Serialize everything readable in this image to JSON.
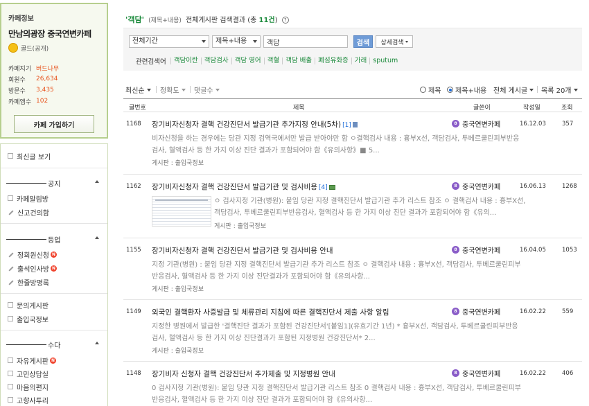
{
  "cafe": {
    "section_label": "카페정보",
    "name": "만남의광장 중국연변카페",
    "grade": "골드(공개)",
    "stats": [
      {
        "label": "카페지기",
        "value": "버드나무"
      },
      {
        "label": "회원수",
        "value": "26,634"
      },
      {
        "label": "방문수",
        "value": "3,435"
      },
      {
        "label": "카페앱수",
        "value": "102"
      }
    ],
    "join_button": "카페 가입하기"
  },
  "menu": {
    "latest": "최신글 보기",
    "group_notice": "공지",
    "notice_items": [
      "카페알림방",
      "신고건의함"
    ],
    "group_rating": "등업",
    "rating_items": [
      "정회원신청",
      "출석인사방",
      "한줄방명록"
    ],
    "misc_items": [
      "문의게시판",
      "출입국정보"
    ],
    "group_chat": "수다",
    "chat_items": [
      "자유게시판",
      "고민상담실",
      "마음의편지",
      "고향사투리"
    ]
  },
  "search": {
    "query": "'객담'",
    "scope": "(제목+내용)",
    "summary_pre": "전체게시판 검색결과 (총 ",
    "count": "11건",
    "summary_post": ")",
    "help": "?",
    "period": "전체기간",
    "field": "제목+내용",
    "input_value": "객담",
    "button": "검색",
    "advanced": "상세검색",
    "related_label": "관련검색어",
    "related": [
      "객담이란",
      "객담검사",
      "객담 영어",
      "객혈",
      "객담 배출",
      "폐섬유화증",
      "가래",
      "sputum"
    ]
  },
  "sort": {
    "latest": "최신순",
    "accuracy": "정확도",
    "comments": "댓글수",
    "radio_title": "제목",
    "radio_title_content": "제목+내용",
    "board_filter": "전체 게시글",
    "list_size": "목록 20개"
  },
  "table": {
    "headers": {
      "num": "글번호",
      "title": "제목",
      "author": "글쓴이",
      "date": "작성일",
      "views": "조회"
    },
    "rows": [
      {
        "num": "1168",
        "title": "장기비자신청자 결핵 건강진단서 발급기관 추가지정 안내(5차)",
        "comments": "[1]",
        "snippet": [
          "비자신청을 하는 경우에는 당관 지정 검역국에서만 발급 받아야만 함 ㅇ결핵검사 내용 : 흉부X선, 객담검사, 투베르쿨린피부반응",
          "검사, 혈액검사 등 한 가지 이상 진단 결과가 포함되어야 함《유의사항》■ 5..."
        ],
        "board": "게시판 : 출입국정보",
        "author": "중국연변카페",
        "level": "8",
        "date": "16.12.03",
        "views": "357"
      },
      {
        "num": "1162",
        "title": "장기비자신청자 결핵 건강진단서 발급기관 및 검사비용",
        "comments": "[4]",
        "snippet": [
          "ㅇ 검사지정 기관(병원): 붙임 당관 지정 결핵진단서 발급기관 추가 리스트 참조 ㅇ 결핵검사 내용 : 흉부X선,",
          "객담검사, 투베르쿨린피부반응검사, 혈액검사 등 한 가지 이상 진단 결과가 포함되어야 함《유의..."
        ],
        "board": "게시판 : 출입국정보",
        "author": "중국연변카페",
        "level": "8",
        "date": "16.06.13",
        "views": "1268"
      },
      {
        "num": "1155",
        "title": "장기비자신청자 결핵 건강진단서 발급기관 및 검사비용 안내",
        "comments": "",
        "snippet": [
          "지정 기관(병원) : 붙임 당관 지정 결핵진단서 발급기관 추가 리스트 참조 ㅇ 결핵검사 내용 : 흉부X선, 객담검사, 투베르쿨린피부",
          "반응검사, 혈액검사 등 한 가지 이상 진단결과가 포함되어야 함《유의사항..."
        ],
        "board": "게시판 : 출입국정보",
        "author": "중국연변카페",
        "level": "8",
        "date": "16.04.05",
        "views": "1053"
      },
      {
        "num": "1149",
        "title": "외국인 결핵환자 사증발급 및 체류관리 지침에 따른 결핵진단서 제출 사항 알림",
        "comments": "",
        "snippet": [
          "지정한 병원에서 발급한 '결핵진단 결과가 포함된 건강진단서'[붙임1](유효기간 1년) * 흉부X선, 객담검사, 투베르쿨린피부반응",
          "검사, 혈액검사 등 한 가지 이상 진단결과가 포함된 지정병원 건강진단서* 2..."
        ],
        "board": "게시판 : 출입국정보",
        "author": "중국연변카페",
        "level": "8",
        "date": "16.02.22",
        "views": "559"
      },
      {
        "num": "1148",
        "title": "장기비자 신청자 결핵 건강진단서 추가제출 및 지정병원 안내",
        "comments": "",
        "snippet": [
          "0 검사지정 기관(병원): 붙임 당관 지정 결핵진단서 발급기관 리스트 참조 0 결핵검사 내용 : 흉부X선, 객담검사, 투베르쿨린피부",
          "반응검사, 혈액검사 등 한 가지 이상 진단 결과가 포함되어야 함《유의사항..."
        ],
        "board": "",
        "author": "중국연변카페",
        "level": "8",
        "date": "16.02.22",
        "views": "406"
      }
    ]
  },
  "colors": {
    "accent_green": "#1c8a3c",
    "link_blue": "#1a6ad8",
    "stat_orange": "#e8541e",
    "search_button": "#6e9bd7"
  }
}
